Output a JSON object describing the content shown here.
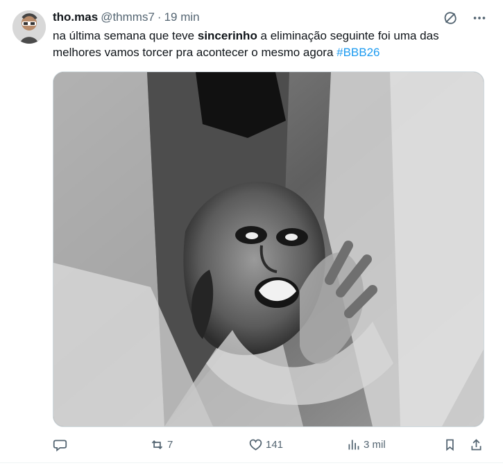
{
  "author": {
    "name": "tho.mas",
    "handle": "@thmms7",
    "separator": "·",
    "time": "19 min"
  },
  "post": {
    "text_before": "na última semana que teve ",
    "bold_text": "sincerinho",
    "text_after": " a eliminação seguinte foi uma das melhores vamos torcer pra acontecer o mesmo agora ",
    "hashtag": "#BBB26"
  },
  "media": {
    "type": "grayscale reaction image"
  },
  "actions": {
    "reply_count": "",
    "retweet_count": "7",
    "like_count": "141",
    "views_count": "3 mil"
  },
  "icons": {
    "top": [
      "grok-icon",
      "more-icon"
    ],
    "bottom": [
      "reply-icon",
      "retweet-icon",
      "like-icon",
      "views-icon",
      "bookmark-icon",
      "share-icon"
    ]
  },
  "colors": {
    "text": "#0f1419",
    "muted": "#536471",
    "link": "#1d9bf0",
    "border": "#cfd9de"
  }
}
